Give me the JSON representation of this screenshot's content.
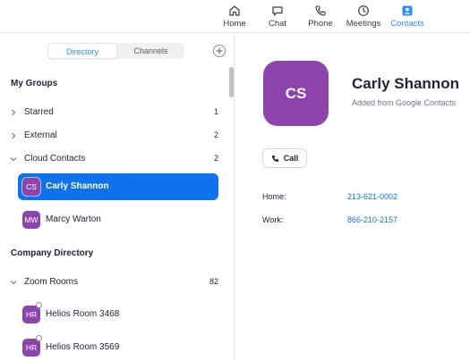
{
  "nav": {
    "home": "Home",
    "chat": "Chat",
    "phone": "Phone",
    "meetings": "Meetings",
    "contacts": "Contacts",
    "active": "Contacts",
    "accent_color": "#2d8cff"
  },
  "sidebar": {
    "tabs": [
      "Directory",
      "Channels"
    ],
    "selected_tab": "Directory",
    "my_groups_title": "My Groups",
    "groups": [
      {
        "name": "Starred",
        "count": "1",
        "expanded": false
      },
      {
        "name": "External",
        "count": "2",
        "expanded": false
      },
      {
        "name": "Cloud Contacts",
        "count": "2",
        "expanded": true
      }
    ],
    "cloud_contacts": [
      {
        "initials": "CS",
        "name": "Carly Shannon",
        "selected": true
      },
      {
        "initials": "MW",
        "name": "Marcy Warton",
        "selected": false
      }
    ],
    "company_directory_title": "Company Directory",
    "zoom_rooms": {
      "name": "Zoom Rooms",
      "count": "82",
      "expanded": true
    },
    "rooms": [
      {
        "initials": "HR",
        "name": "Helios Room 3468"
      },
      {
        "initials": "HR",
        "name": "Helios Room 3569"
      }
    ],
    "selected_color": "#0e72ed",
    "avatar_color": "#8e44ad"
  },
  "profile": {
    "initials": "CS",
    "name": "Carly Shannon",
    "source": "Added from Google Contacts",
    "call_label": "Call",
    "fields": [
      {
        "label": "Home:",
        "value": "213-621-0002"
      },
      {
        "label": "Work:",
        "value": "866-210-2157"
      }
    ]
  }
}
